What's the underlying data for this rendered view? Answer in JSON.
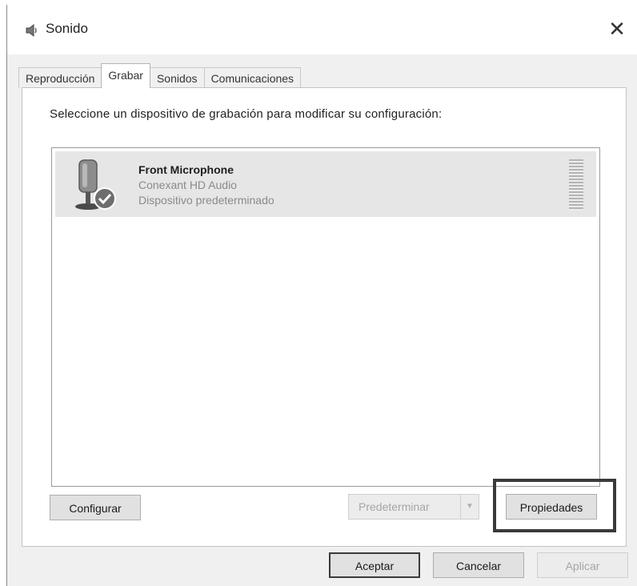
{
  "window": {
    "title": "Sonido",
    "close_glyph": "✕"
  },
  "tabs": [
    {
      "label": "Reproducción",
      "active": false
    },
    {
      "label": "Grabar",
      "active": true
    },
    {
      "label": "Sonidos",
      "active": false
    },
    {
      "label": "Comunicaciones",
      "active": false
    }
  ],
  "panel": {
    "instruction": "Seleccione un dispositivo de grabación para modificar su configuración:"
  },
  "devices": [
    {
      "name": "Front Microphone",
      "driver": "Conexant HD Audio",
      "status": "Dispositivo predeterminado",
      "icon": "microphone-icon",
      "default_badge_icon": "check-icon",
      "selected": true
    }
  ],
  "buttons": {
    "configure": "Configurar",
    "set_default": "Predeterminar",
    "set_default_arrow": "▼",
    "properties": "Propiedades",
    "accept": "Aceptar",
    "cancel": "Cancelar",
    "apply": "Aplicar"
  },
  "colors": {
    "selection": "#e6e6e6",
    "highlight_frame": "#3a3a3a",
    "dialog_background": "#f0f0f0"
  }
}
